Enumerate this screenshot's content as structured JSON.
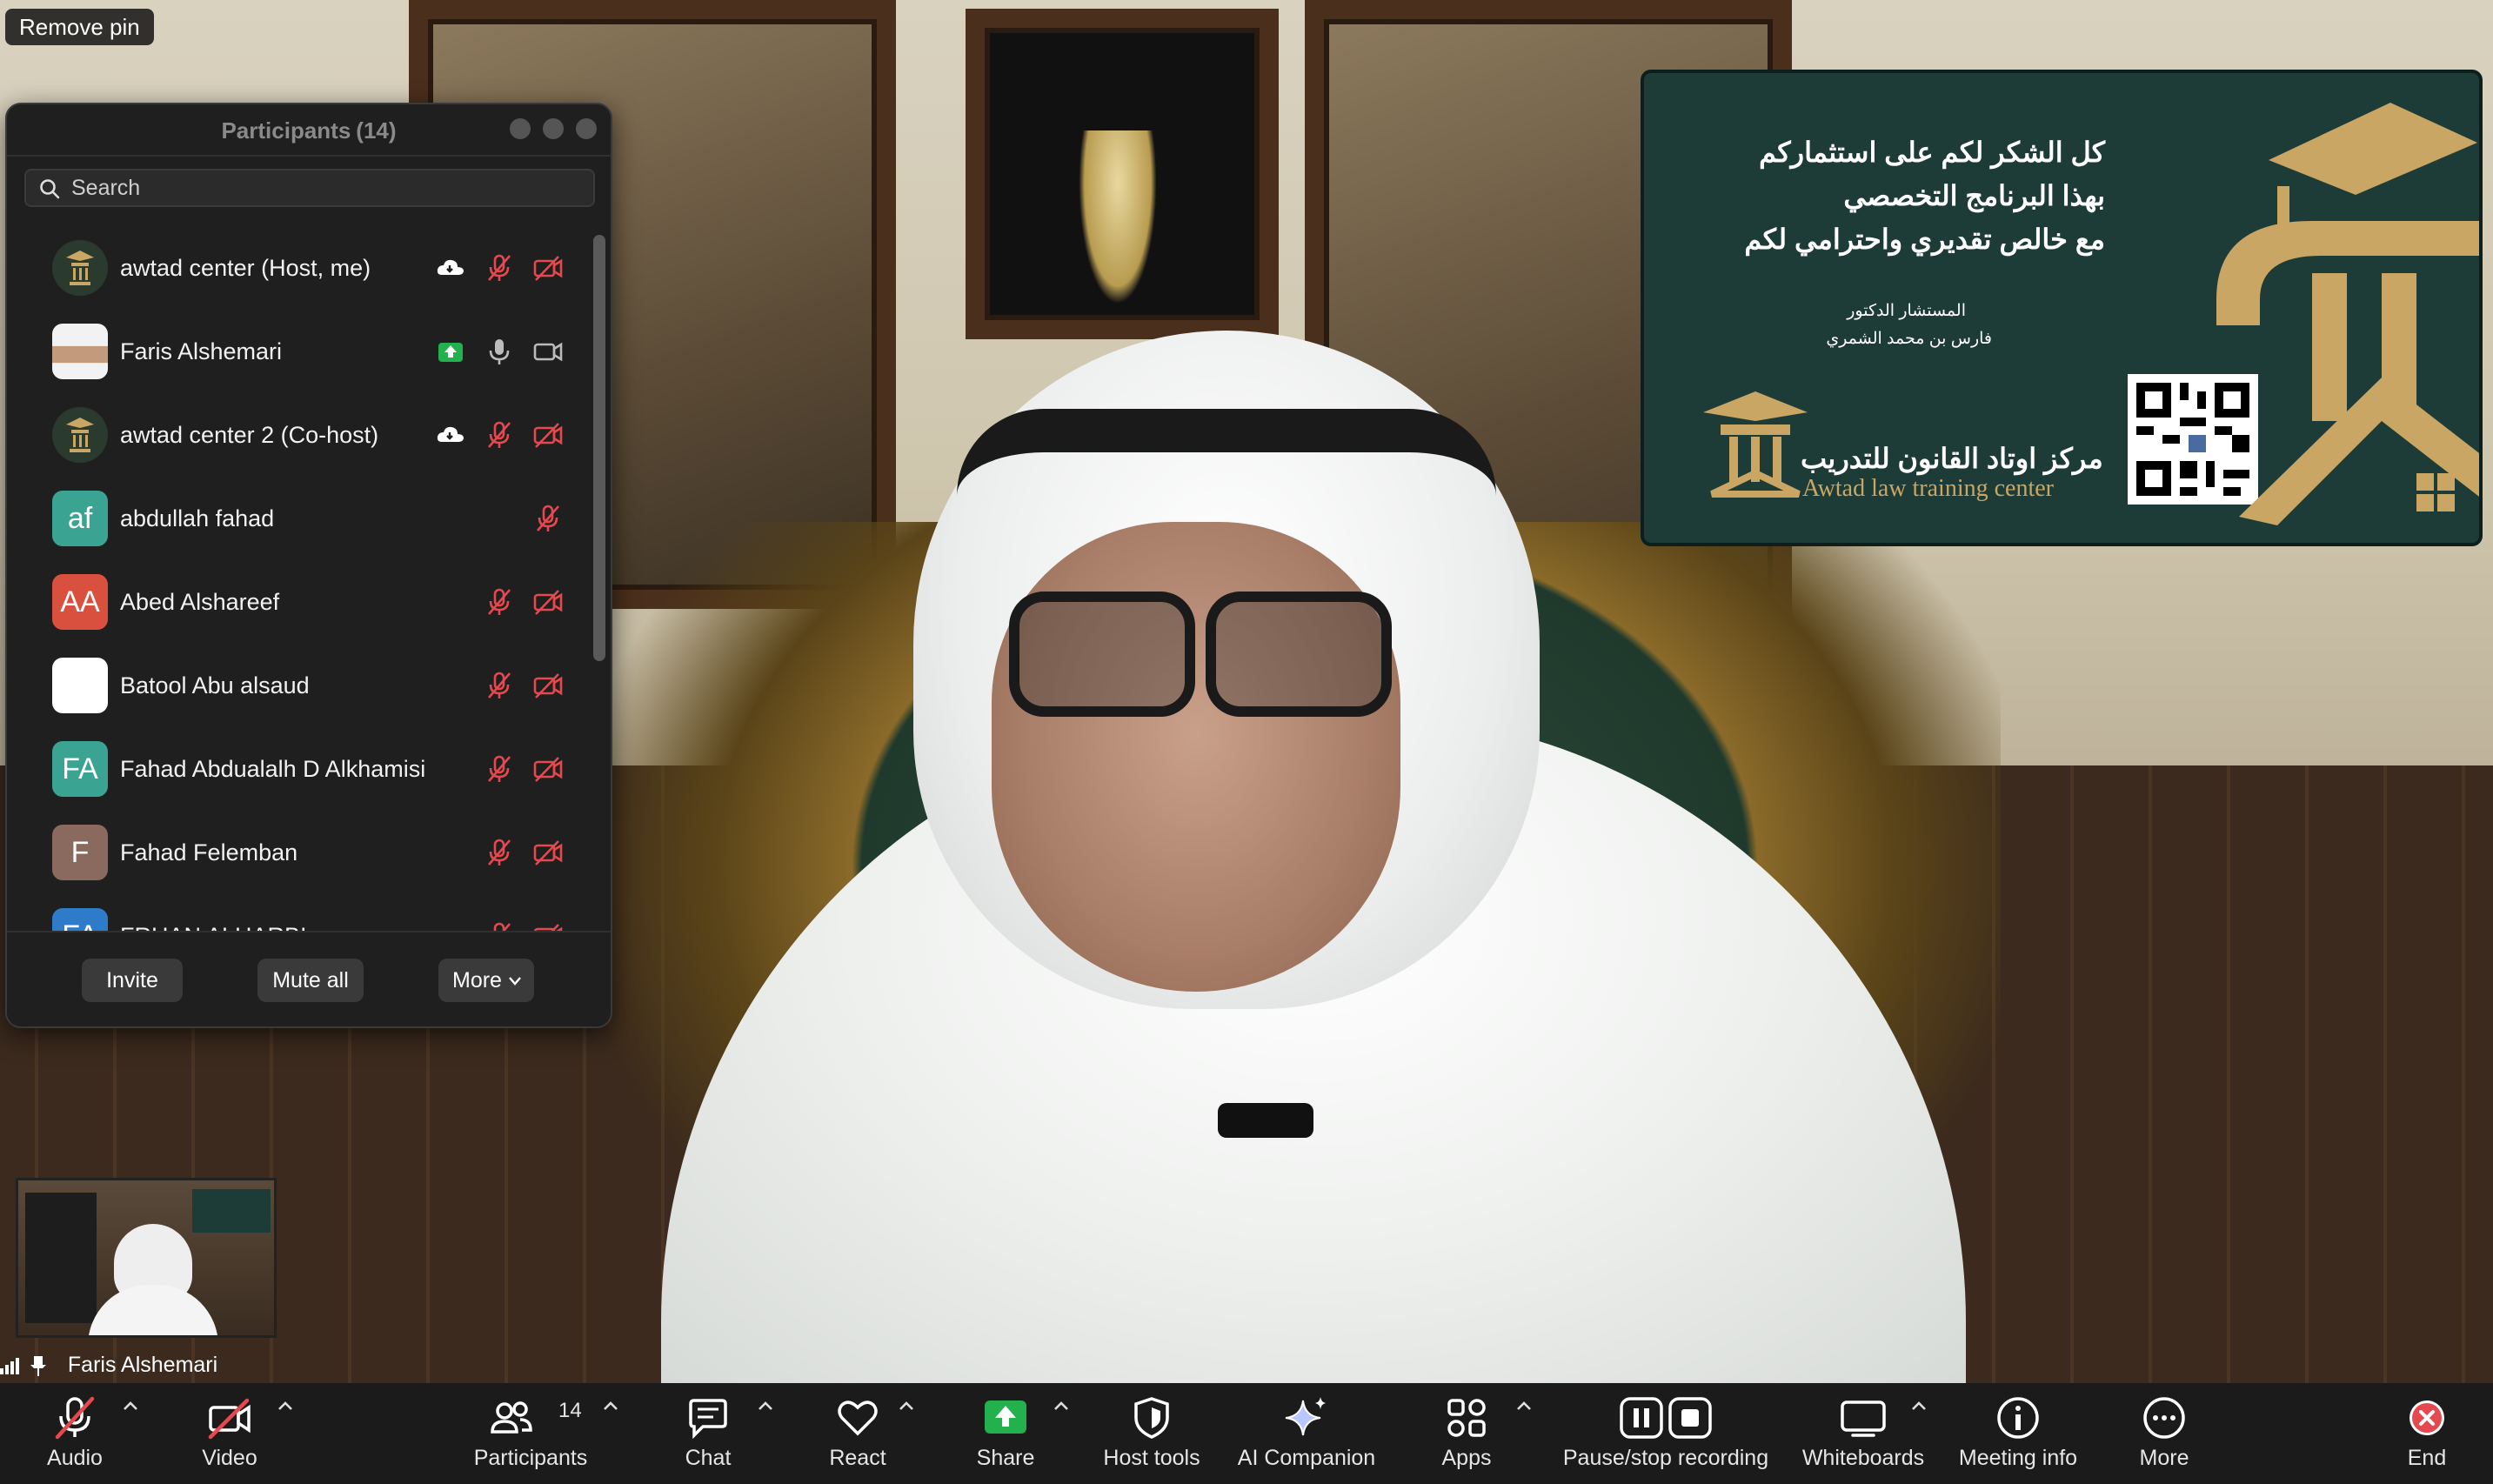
{
  "remove_pin": "Remove pin",
  "participants": {
    "title": "Participants",
    "count": "(14)",
    "search_placeholder": "Search",
    "list": [
      {
        "name": "awtad center (Host, me)",
        "initials": "",
        "avatar_color": "#2a3a2f"
      },
      {
        "name": "Faris Alshemari",
        "initials": "",
        "avatar_color": "#c7c2b8"
      },
      {
        "name": "awtad center 2 (Co-host)",
        "initials": "",
        "avatar_color": "#2a3a2f"
      },
      {
        "name": "abdullah fahad",
        "initials": "af",
        "avatar_color": "#3aa391"
      },
      {
        "name": "Abed Alshareef",
        "initials": "AA",
        "avatar_color": "#d9503e"
      },
      {
        "name": "Batool Abu alsaud",
        "initials": "",
        "avatar_color": "#ffffff"
      },
      {
        "name": "Fahad Abdualalh D Alkhamisi",
        "initials": "FA",
        "avatar_color": "#3aa391"
      },
      {
        "name": "Fahad Felemban",
        "initials": "F",
        "avatar_color": "#8a6a5e"
      },
      {
        "name": "FRHAN ALHARBI",
        "initials": "FA",
        "avatar_color": "#2e7cc9"
      }
    ],
    "invite_label": "Invite",
    "mute_all_label": "Mute all",
    "more_label": "More"
  },
  "slide": {
    "line1": "كل الشكر لكم على استثماركم",
    "line2": "بهذا البرنامج التخصصي",
    "line3": "مع خالص تقديري واحترامي لكم",
    "sig_title": "المستشار الدكتور",
    "sig_name": "فارس بن محمد الشمري",
    "org_ar": "مركز اوتاد القانون للتدريب",
    "org_en": "Awtad law training center",
    "colors": {
      "bg": "#1e3c37",
      "gold": "#c9a664"
    }
  },
  "self_view": {
    "name": "Faris Alshemari"
  },
  "toolbar": {
    "audio": "Audio",
    "video": "Video",
    "participants": "Participants",
    "participants_count": "14",
    "chat": "Chat",
    "react": "React",
    "share": "Share",
    "host_tools": "Host tools",
    "ai_companion": "AI Companion",
    "apps": "Apps",
    "recording": "Pause/stop recording",
    "whiteboards": "Whiteboards",
    "meeting_info": "Meeting info",
    "more": "More",
    "end": "End",
    "colors": {
      "muted": "#e5484d",
      "share": "#23b14d",
      "end": "#e5484d"
    }
  }
}
